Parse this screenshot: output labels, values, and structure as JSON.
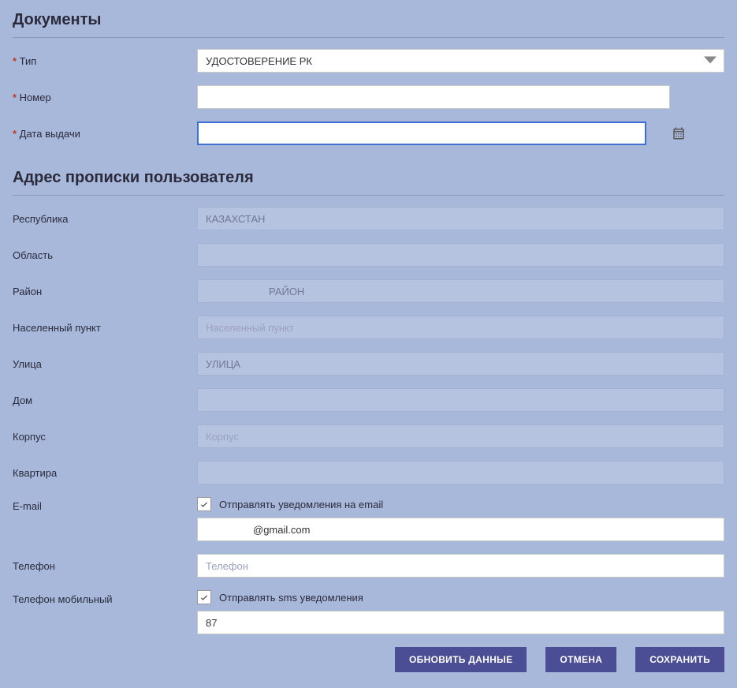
{
  "sections": {
    "documents_title": "Документы",
    "address_title": "Адрес прописки пользователя"
  },
  "documents": {
    "type_label": "Тип",
    "type_value": "УДОСТОВЕРЕНИЕ РК",
    "number_label": "Номер",
    "number_value": "",
    "issue_date_label": "Дата выдачи",
    "issue_date_value": ""
  },
  "address": {
    "republic_label": "Республика",
    "republic_value": "КАЗАХСТАН",
    "region_label": "Область",
    "region_value": "",
    "district_label": "Район",
    "district_value": "РАЙОН",
    "settlement_label": "Населенный пункт",
    "settlement_placeholder": "Населенный пункт",
    "settlement_value": "",
    "street_label": "Улица",
    "street_value": "УЛИЦА",
    "house_label": "Дом",
    "house_value": "",
    "building_label": "Корпус",
    "building_placeholder": "Корпус",
    "building_value": "",
    "apartment_label": "Квартира",
    "apartment_value": ""
  },
  "contact": {
    "email_label": "E-mail",
    "email_notify_label": "Отправлять уведомления на email",
    "email_notify_checked": true,
    "email_value": "@gmail.com",
    "phone_label": "Телефон",
    "phone_placeholder": "Телефон",
    "phone_value": "",
    "mobile_label": "Телефон мобильный",
    "sms_notify_label": "Отправлять sms уведомления",
    "sms_notify_checked": true,
    "mobile_value": "87"
  },
  "buttons": {
    "update": "ОБНОВИТЬ ДАННЫЕ",
    "cancel": "ОТМЕНА",
    "save": "СОХРАНИТЬ"
  }
}
